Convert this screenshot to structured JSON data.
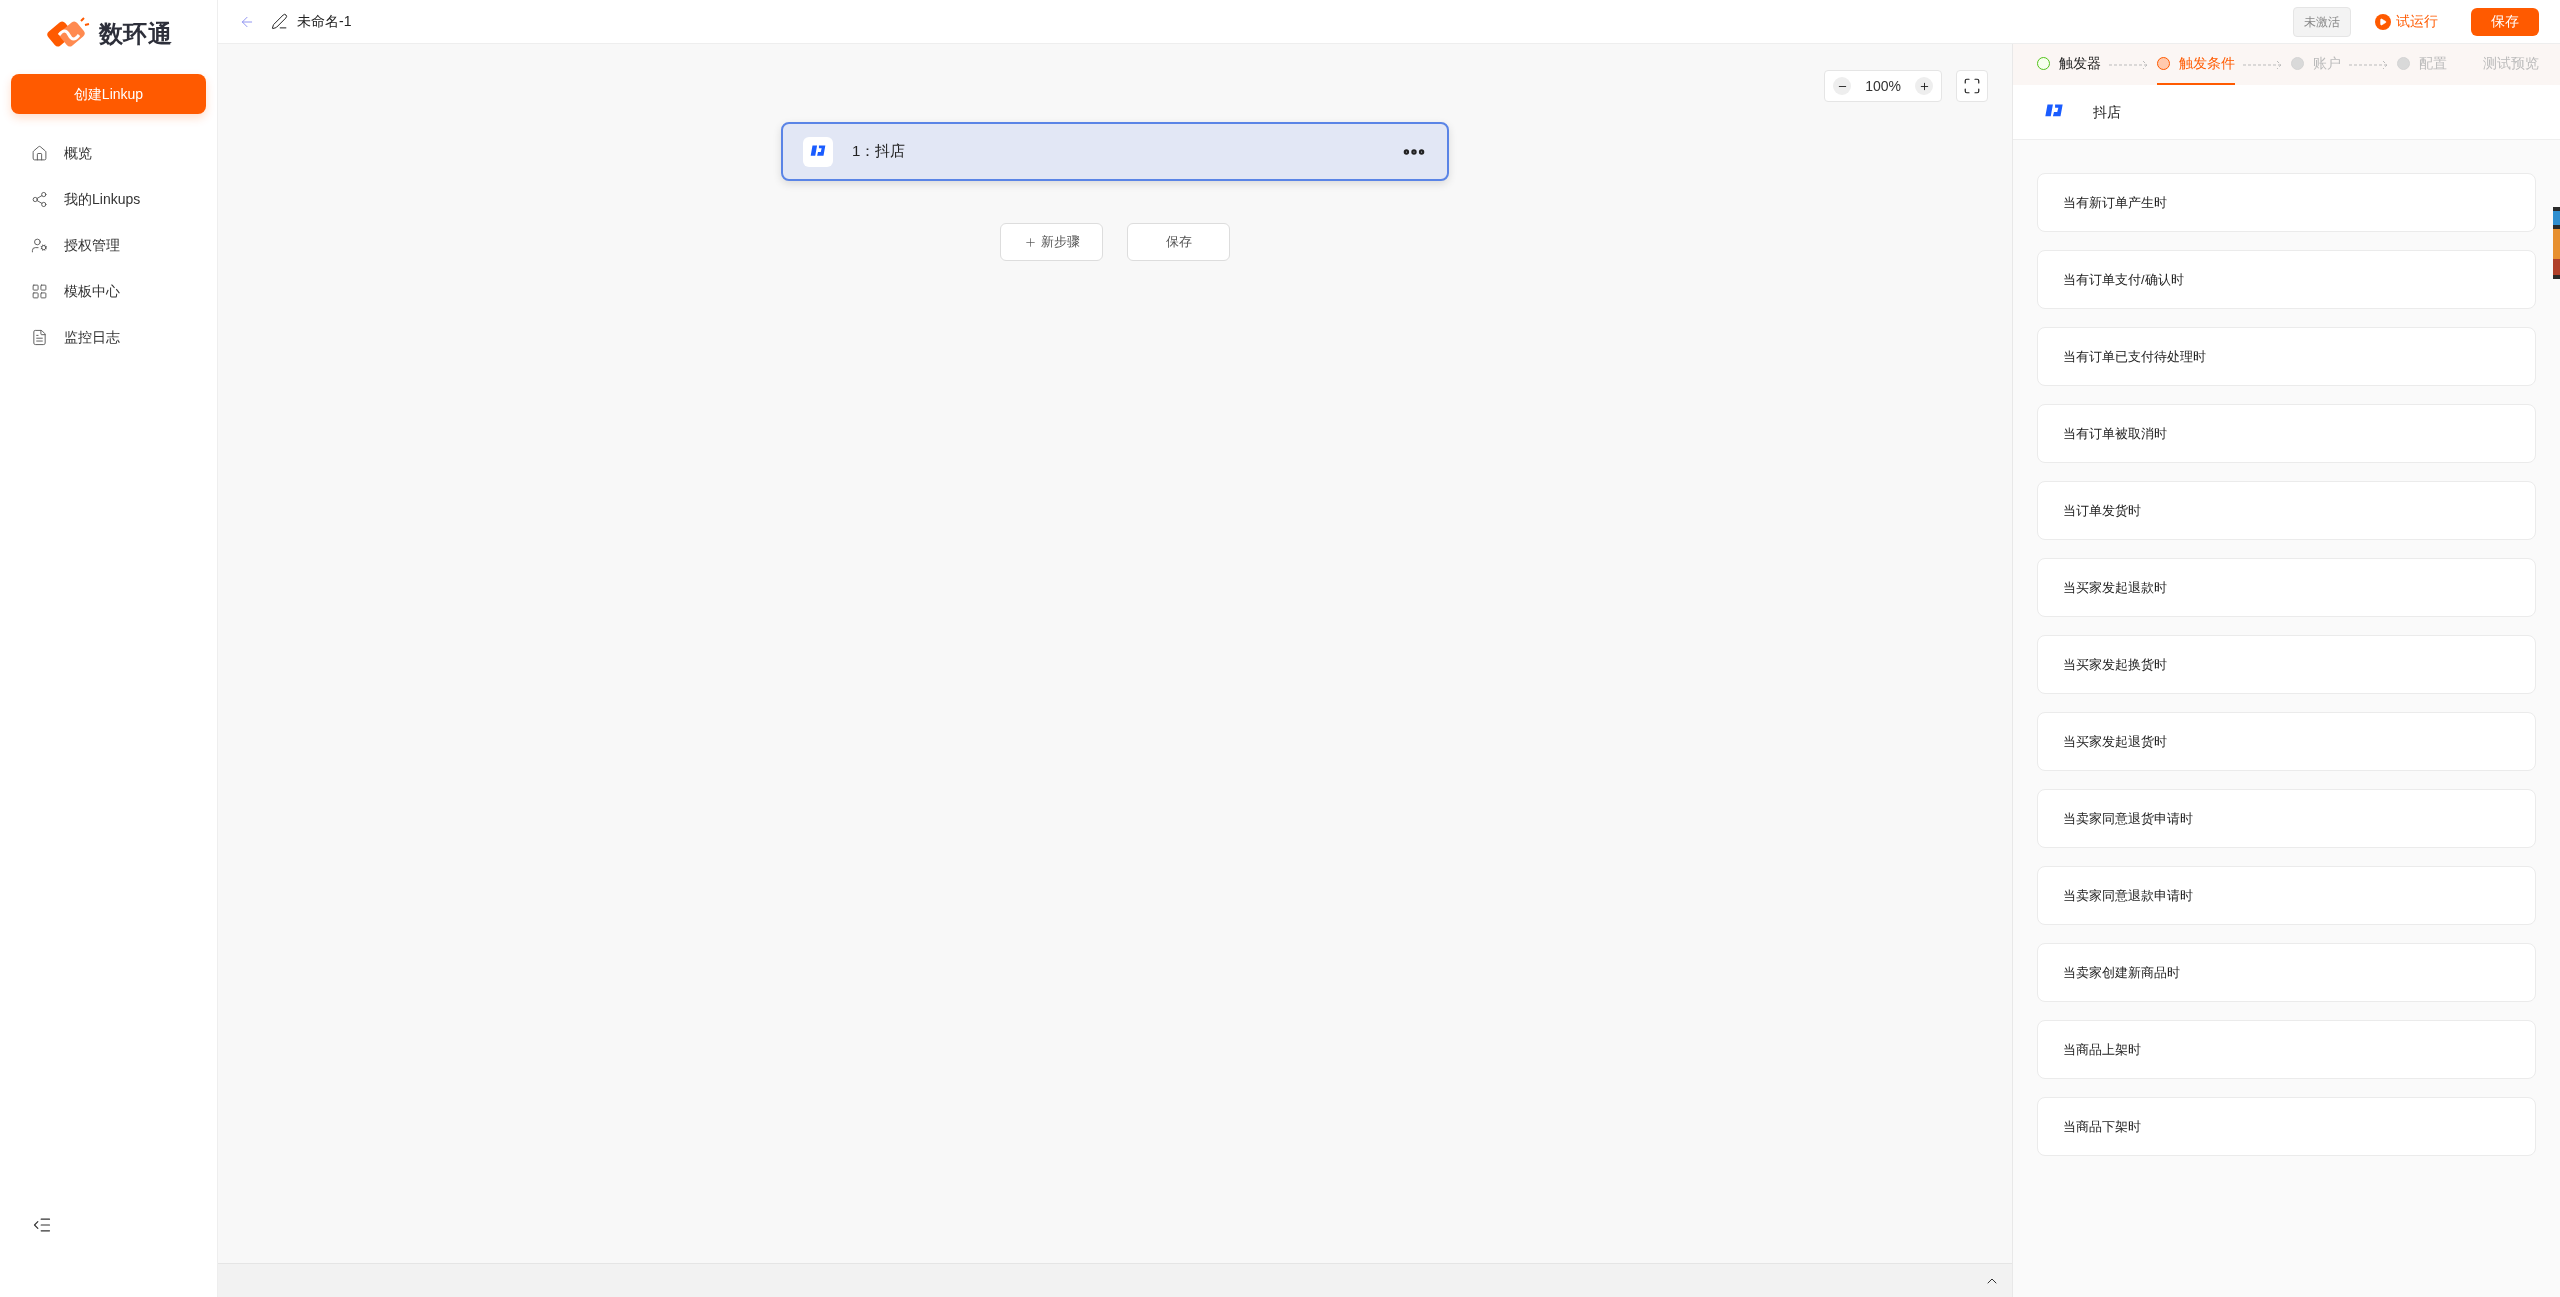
{
  "sidebar": {
    "logo_text": "数环通",
    "create_button": "创建Linkup",
    "items": [
      {
        "label": "概览",
        "selected": false
      },
      {
        "label": "我的Linkups",
        "selected": false
      },
      {
        "label": "授权管理",
        "selected": false
      },
      {
        "label": "模板中心",
        "selected": false
      },
      {
        "label": "监控日志",
        "selected": false
      }
    ]
  },
  "header": {
    "title": "未命名-1",
    "status_badge": "未激活",
    "test_run": "试运行",
    "save": "保存"
  },
  "canvas": {
    "zoom": "100%",
    "node": {
      "label": "1：抖店",
      "selected": true
    },
    "new_step": "新步骤",
    "save": "保存"
  },
  "steps": [
    {
      "label": "触发器",
      "kind": "done",
      "selected": false,
      "dot": true
    },
    {
      "label": "触发条件",
      "kind": "current",
      "selected": true,
      "dot": true
    },
    {
      "label": "账户",
      "kind": "pending",
      "selected": false,
      "dot": true
    },
    {
      "label": "配置",
      "kind": "pending",
      "selected": false,
      "dot": true
    },
    {
      "label": "测试预览",
      "kind": "pending",
      "selected": false,
      "dot": false
    }
  ],
  "app": {
    "name": "抖店"
  },
  "triggers": [
    {
      "label": "当有新订单产生时"
    },
    {
      "label": "当有订单支付/确认时"
    },
    {
      "label": "当有订单已支付待处理时"
    },
    {
      "label": "当有订单被取消时"
    },
    {
      "label": "当订单发货时"
    },
    {
      "label": "当买家发起退款时"
    },
    {
      "label": "当买家发起换货时"
    },
    {
      "label": "当买家发起退货时"
    },
    {
      "label": "当卖家同意退货申请时"
    },
    {
      "label": "当卖家同意退款申请时"
    },
    {
      "label": "当卖家创建新商品时"
    },
    {
      "label": "当商品上架时"
    },
    {
      "label": "当商品下架时"
    }
  ]
}
